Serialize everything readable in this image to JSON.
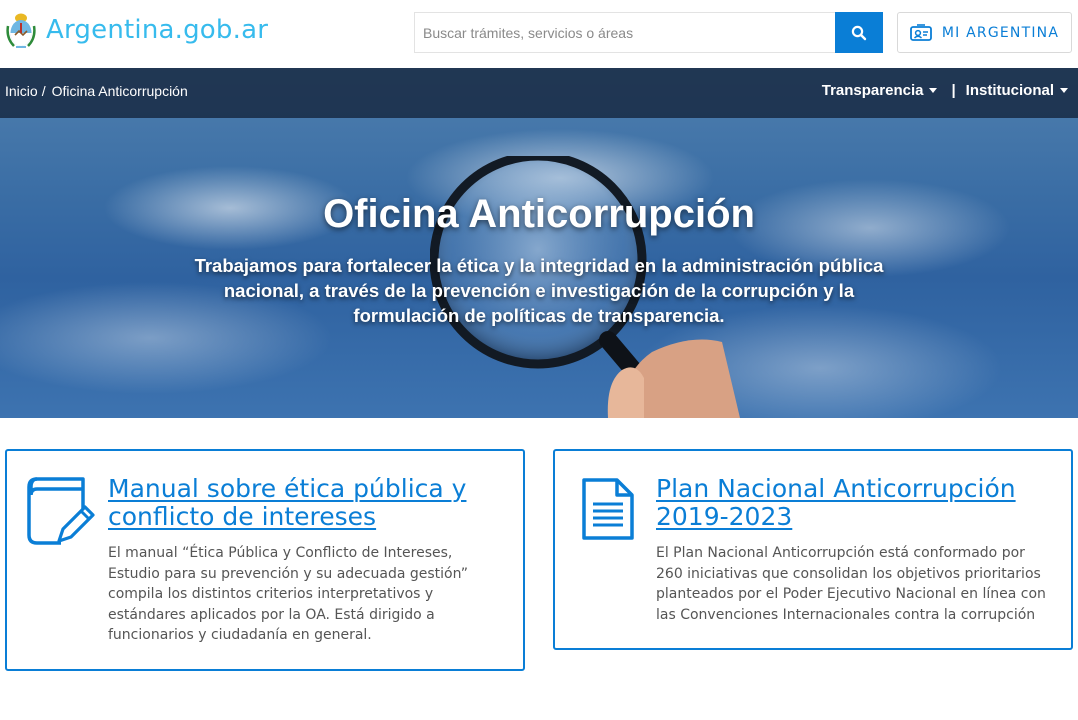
{
  "header": {
    "logo_text": "Argentina.gob.ar",
    "search_placeholder": "Buscar trámites, servicios o áreas",
    "mi_argentina_label": "MI ARGENTINA",
    "accent": "#0a7ed6",
    "logo_color": "#37bbed"
  },
  "breadcrumb": {
    "home": "Inicio",
    "separator": "/",
    "current": "Oficina Anticorrupción"
  },
  "top_menu": {
    "transparencia": "Transparencia",
    "divider": "|",
    "institucional": "Institucional"
  },
  "hero": {
    "title": "Oficina Anticorrupción",
    "subtitle": "Trabajamos para fortalecer la ética y la integridad en la administración pública nacional, a través de la prevención e investigación de la corrupción y la formulación de políticas de transparencia."
  },
  "cards": [
    {
      "icon": "book-pencil-icon",
      "title": "Manual sobre ética pública y conflicto de intereses",
      "description": "El manual “Ética Pública y Conflicto de Intereses, Estudio para su prevención y su adecuada gestión” compila los distintos criterios interpretativos y estándares aplicados por la OA. Está dirigido a funcionarios y ciudadanía en general."
    },
    {
      "icon": "document-icon",
      "title": "Plan Nacional Anticorrupción 2019-2023",
      "description": "El Plan Nacional Anticorrupción está conformado por 260 iniciativas que consolidan los objetivos prioritarios planteados por el Poder Ejecutivo Nacional en línea con las Convenciones Internacionales contra la corrupción"
    }
  ]
}
